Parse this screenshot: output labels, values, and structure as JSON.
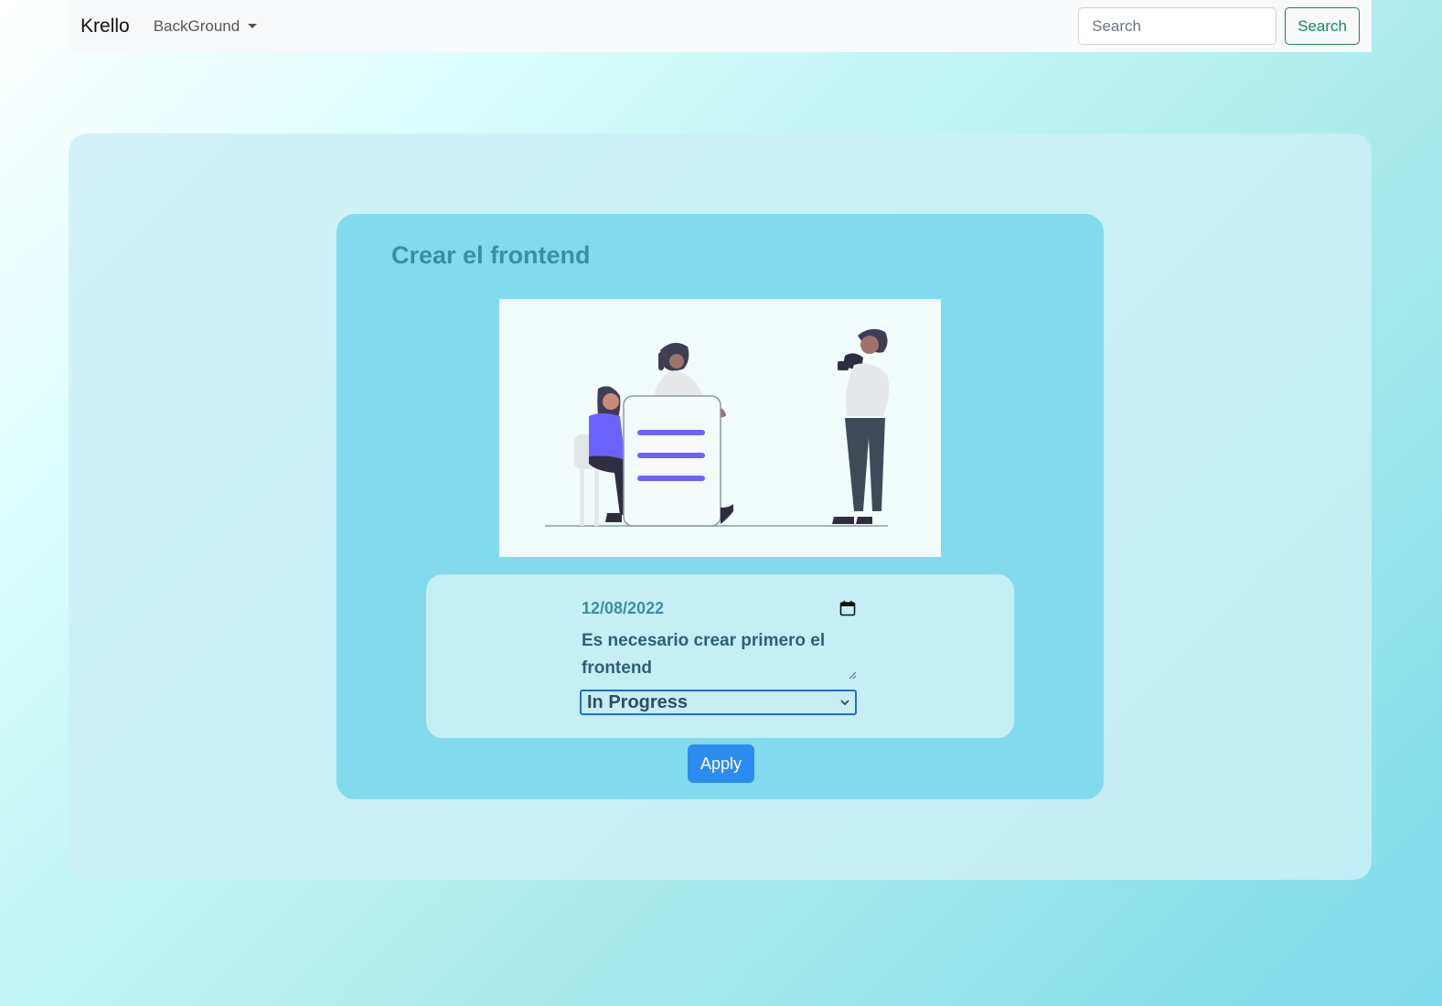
{
  "navbar": {
    "brand": "Krello",
    "dropdown_label": "BackGround",
    "search_placeholder": "Search",
    "search_button": "Search"
  },
  "task": {
    "title": "Crear el frontend",
    "date": "12/08/2022",
    "description": "Es necesario crear primero el frontend",
    "status": "In Progress",
    "apply_label": "Apply"
  },
  "colors": {
    "brand_green": "#198754",
    "apply_blue": "#2d8cf0",
    "title_teal": "#3a8f9e",
    "illustration_purple": "#6c63ff"
  },
  "icons": [
    "chevron-down-icon",
    "calendar-icon",
    "resize-grip-icon",
    "chevron-down-icon"
  ]
}
